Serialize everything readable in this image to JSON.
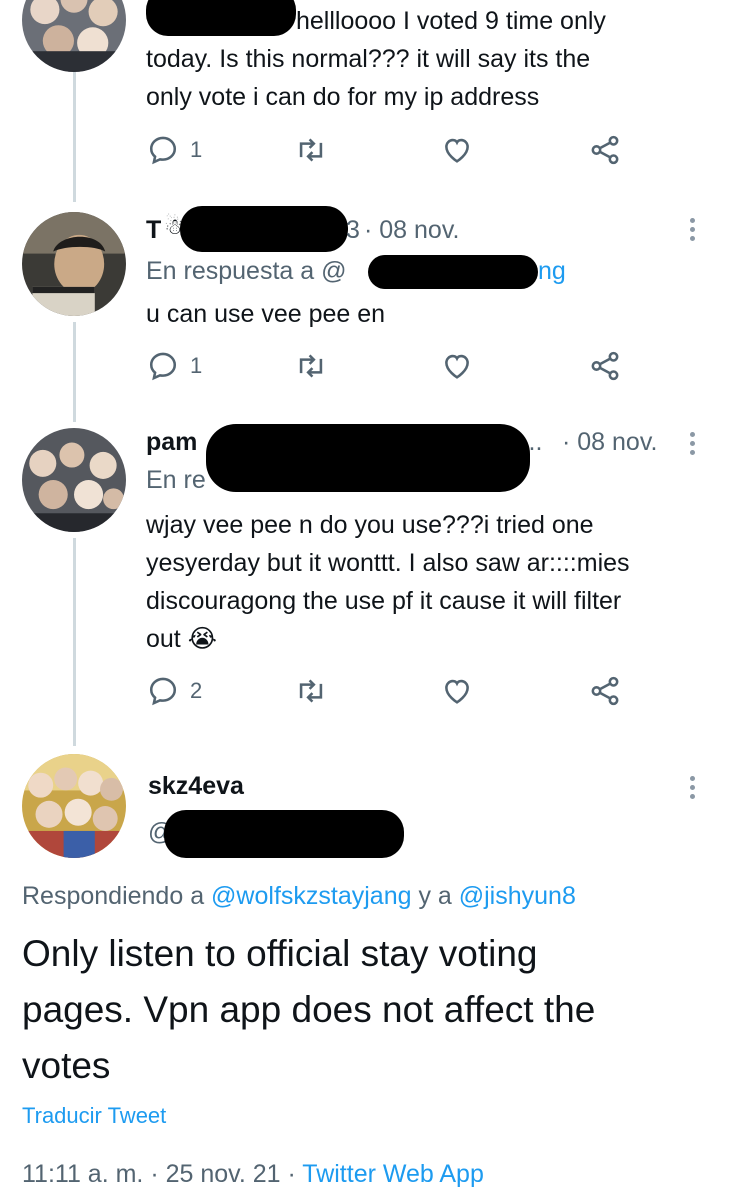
{
  "tweet1": {
    "body_line1": "hellloooo I voted 9 time only",
    "body_line2": "today. Is this normal??? it will say its the",
    "body_line3": "only vote i can do for my ip address",
    "replies": "1"
  },
  "tweet2": {
    "name_visible": "T",
    "date": "· 08 nov.",
    "handle_tail_digit": "3",
    "reply_prefix": "En respuesta a @",
    "reply_tail": "ng",
    "body": "u can use vee pee en",
    "replies": "1"
  },
  "tweet3": {
    "name_visible": "pam",
    "name_tail": "l...",
    "date": "· 08 nov.",
    "reply_prefix": "En re",
    "body_line1": "wjay vee pee n do you use???i tried one",
    "body_line2": "yesyerday but it wonttt. I also saw ar::::mies",
    "body_line3": "discouragong the use pf it cause it will filter",
    "body_line4": "out",
    "emoji": "😭",
    "replies": "2"
  },
  "main_tweet": {
    "name": "skz4eva",
    "handle_prefix": "@",
    "replying_prefix": "Respondiendo a ",
    "reply_user1": "@wolfskzstayjang",
    "reply_joiner": " y a ",
    "reply_user2": "@jishyun8",
    "body_line1": "Only listen to official stay voting",
    "body_line2": "pages. Vpn app does not affect the",
    "body_line3": "votes",
    "translate": "Traducir Tweet",
    "time": "11:11 a. m.",
    "date": "25 nov. 21",
    "sep": "·",
    "source": "Twitter Web App"
  },
  "icons": [
    "reply-icon",
    "retweet-icon",
    "like-icon",
    "share-icon",
    "more-icon"
  ],
  "colors": {
    "link": "#1d9bf0",
    "meta": "#536471",
    "thread_line": "#cfd9de"
  }
}
